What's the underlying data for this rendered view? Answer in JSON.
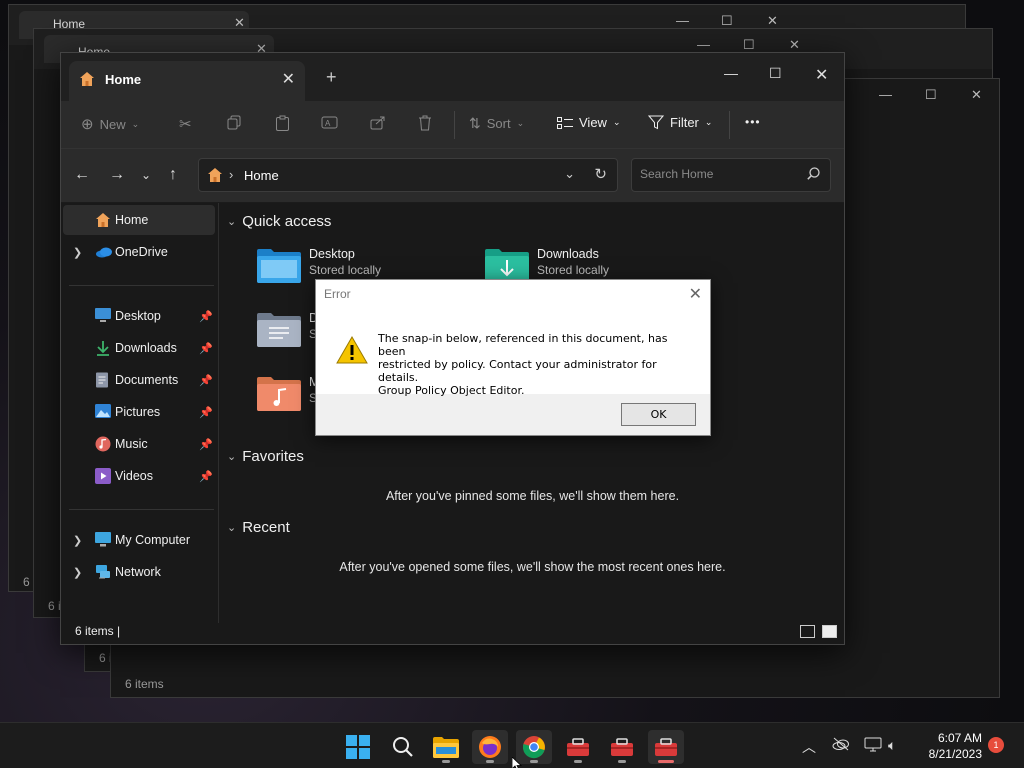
{
  "background_windows": [
    {
      "tab_title": "Home",
      "status": "6 i"
    },
    {
      "tab_title": "Home",
      "status": "6 i"
    },
    {
      "status": "6 items"
    },
    {
      "status": "6 items"
    }
  ],
  "window": {
    "tab_title": "Home",
    "toolbar": {
      "new_label": "New",
      "sort_label": "Sort",
      "view_label": "View",
      "filter_label": "Filter",
      "more_label": "•••"
    },
    "address": {
      "path": "Home"
    },
    "search": {
      "placeholder": "Search Home"
    },
    "sidebar": {
      "home": "Home",
      "onedrive": "OneDrive",
      "pinned": [
        {
          "label": "Desktop",
          "icon": "desktop-icon",
          "color": "#4aa3df"
        },
        {
          "label": "Downloads",
          "icon": "download-icon",
          "color": "#3db36b"
        },
        {
          "label": "Documents",
          "icon": "documents-icon",
          "color": "#a0a8b8"
        },
        {
          "label": "Pictures",
          "icon": "pictures-icon",
          "color": "#3a8fd9"
        },
        {
          "label": "Music",
          "icon": "music-icon",
          "color": "#e0665e"
        },
        {
          "label": "Videos",
          "icon": "videos-icon",
          "color": "#8b5cc8"
        }
      ],
      "my_computer": "My Computer",
      "network": "Network"
    },
    "content": {
      "quick_access_title": "Quick access",
      "quick_access": [
        {
          "name": "Desktop",
          "sub": "Stored locally"
        },
        {
          "name": "Downloads",
          "sub": "Stored locally"
        },
        {
          "name": "D",
          "sub": "St"
        },
        {
          "name": "M",
          "sub": "St"
        }
      ],
      "favorites_title": "Favorites",
      "favorites_empty": "After you've pinned some files, we'll show them here.",
      "recent_title": "Recent",
      "recent_empty": "After you've opened some files, we'll show the most recent ones here."
    },
    "status": {
      "count": "6 items",
      "sep": "|"
    }
  },
  "dialog": {
    "title": "Error",
    "message_line1": "The snap-in below, referenced in this document, has been",
    "message_line2": "restricted by policy. Contact your administrator for details.",
    "message_line3": "Group Policy Object Editor.",
    "ok_label": "OK"
  },
  "taskbar": {
    "time": "6:07 AM",
    "date": "8/21/2023",
    "notification_count": "1",
    "apps": [
      "start-icon",
      "search-icon",
      "file-explorer-icon",
      "firefox-icon",
      "chrome-icon",
      "toolbox-icon",
      "toolbox-icon",
      "toolbox-icon"
    ]
  }
}
